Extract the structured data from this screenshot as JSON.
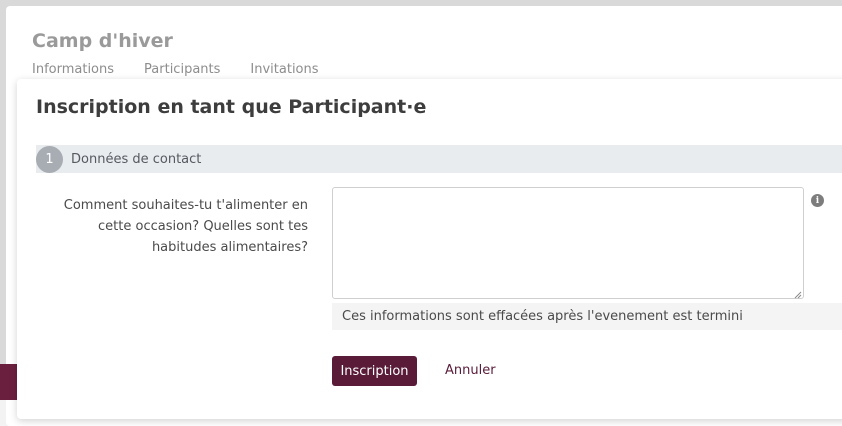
{
  "background_page": {
    "title": "Camp d'hiver",
    "tabs": [
      {
        "label": "Informations"
      },
      {
        "label": "Participants"
      },
      {
        "label": "Invitations"
      }
    ]
  },
  "modal": {
    "title": "Inscription en tant que Participant·e",
    "step": {
      "number": "1",
      "label": "Données de contact"
    },
    "field": {
      "label": "Comment souhaites-tu t'alimenter en cette occasion? Quelles sont tes habitudes alimentaires?",
      "value": "",
      "help_text": "Ces informations sont effacées après l'evenement est termini",
      "info_icon": "info-icon"
    },
    "actions": {
      "submit_label": "Inscription",
      "cancel_label": "Annuler"
    }
  },
  "colors": {
    "primary": "#5a1b38",
    "step_bar": "#e9ecef",
    "step_circle": "#a8adb4"
  }
}
